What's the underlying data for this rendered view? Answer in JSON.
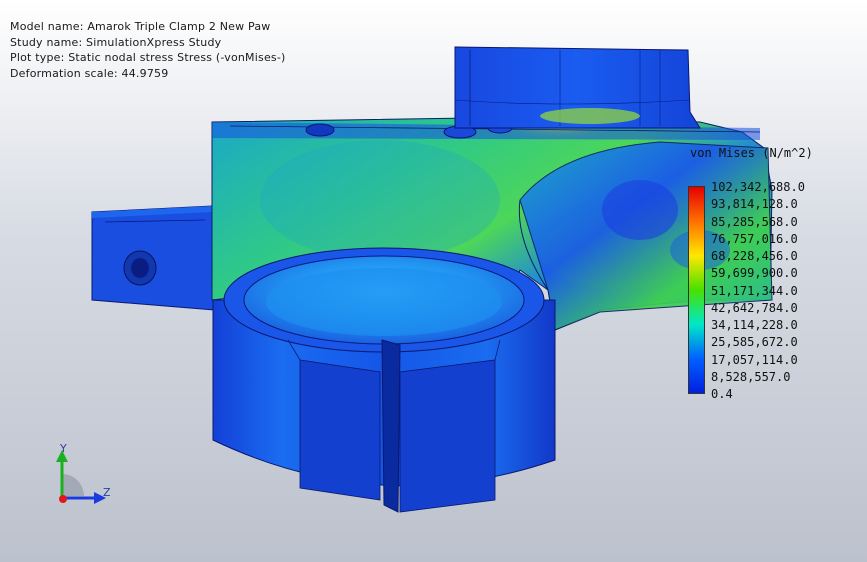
{
  "info": {
    "model_name": "Model name: Amarok Triple Clamp 2 New Paw",
    "study_name": "Study name: SimulationXpress Study",
    "plot_type": "Plot type: Static nodal stress Stress (-vonMises-)",
    "deformation_scale": "Deformation scale: 44.9759"
  },
  "legend": {
    "title": "von Mises (N/m^2)",
    "values": [
      "102,342,688.0",
      "93,814,128.0",
      "85,285,568.0",
      "76,757,016.0",
      "68,228,456.0",
      "59,699,900.0",
      "51,171,344.0",
      "42,642,784.0",
      "34,114,228.0",
      "25,585,672.0",
      "17,057,114.0",
      "8,528,557.0",
      "0.4"
    ],
    "colors": [
      "#e60000",
      "#ff7000",
      "#ffe800",
      "#48e000",
      "#00e8c8",
      "#0060ff",
      "#0020e0"
    ]
  },
  "triad": {
    "y_label": "Y",
    "z_label": "Z"
  }
}
